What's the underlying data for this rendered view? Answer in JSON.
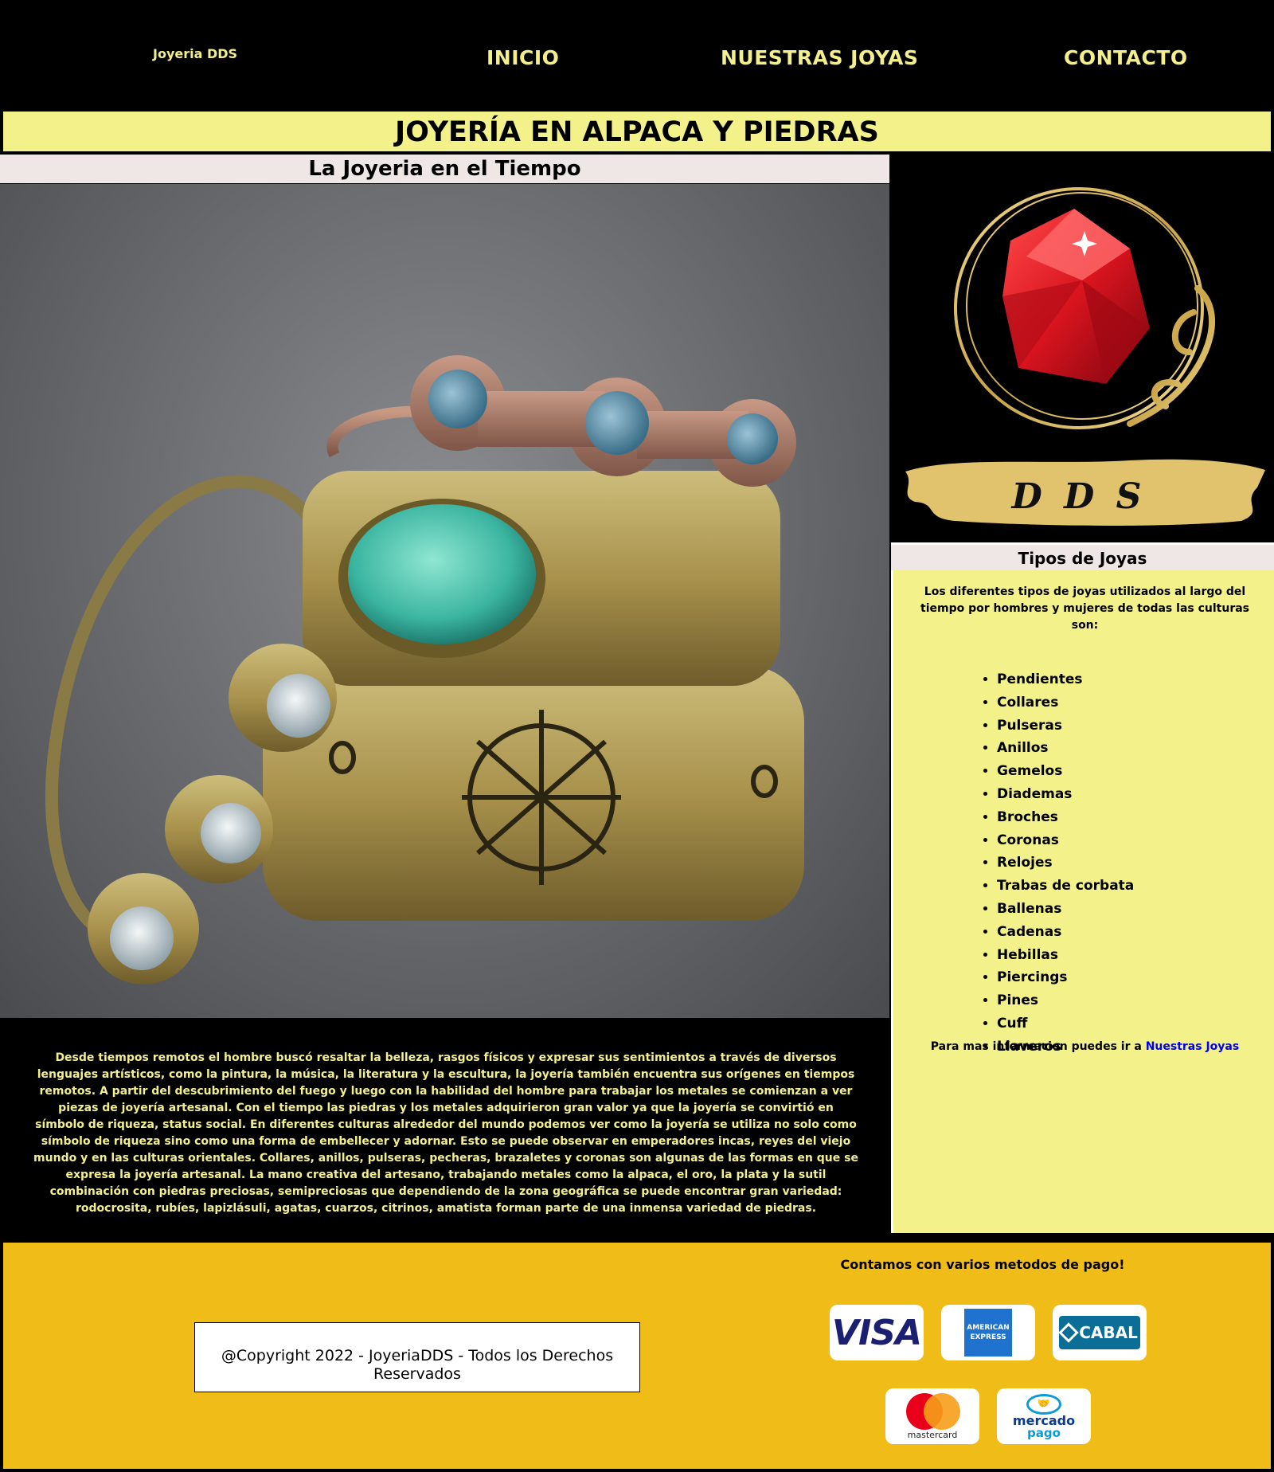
{
  "nav": {
    "brand": "Joyeria DDS",
    "links": [
      "INICIO",
      "NUESTRAS JOYAS",
      "CONTACTO"
    ]
  },
  "banner": {
    "title": "JOYERÍA EN ALPACA Y PIEDRAS"
  },
  "main": {
    "subtitle": "La Joyeria en el Tiempo",
    "story": "Desde tiempos remotos el hombre buscó resaltar la belleza, rasgos físicos y expresar sus sentimientos a través de diversos lenguajes artísticos, como la pintura, la música, la literatura y la escultura, la joyería también encuentra sus orígenes en tiempos remotos. A partir del descubrimiento del fuego y luego con la habilidad del hombre para trabajar los metales se comienzan a ver piezas de joyería artesanal. Con el tiempo las piedras y los metales adquirieron gran valor ya que la joyería se convirtió en símbolo de riqueza, status social. En diferentes culturas alrededor del mundo podemos ver como la joyería se utiliza no solo como símbolo de riqueza sino como una forma de embellecer y adornar. Esto se puede observar en emperadores incas, reyes del viejo mundo y en las culturas orientales. Collares, anillos, pulseras, pecheras, brazaletes y coronas son algunas de las formas en que se expresa la joyería artesanal. La mano creativa del artesano, trabajando metales como la alpaca, el oro, la plata y la sutil combinación con piedras preciosas, semipreciosas que dependiendo de la zona geográfica se puede encontrar gran variedad: rodocrosita, rubíes, lapizlásuli, agatas, cuarzos, citrinos, amatista forman parte de una inmensa variedad de piedras."
  },
  "sidebar": {
    "logo_text": "D D S",
    "title": "Tipos de Joyas",
    "intro": "Los diferentes tipos de joyas utilizados al largo del tiempo por hombres y mujeres de todas las culturas son:",
    "items": [
      "Pendientes",
      "Collares",
      "Pulseras",
      "Anillos",
      "Gemelos",
      "Diademas",
      "Broches",
      "Coronas",
      "Relojes",
      "Trabas de corbata",
      "Ballenas",
      "Cadenas",
      "Hebillas",
      "Piercings",
      "Pines",
      "Cuff",
      "Llaveros"
    ],
    "more_prefix": "Para mas informacion puedes ir a",
    "more_link": "Nuestras Joyas"
  },
  "footer": {
    "copyright": "@Copyright 2022 - JoyeriaDDS - Todos los Derechos Reservados",
    "payment_title": "Contamos con varios metodos de pago!",
    "payment_methods": {
      "visa": "VISA",
      "amex_line1": "AMERICAN",
      "amex_line2": "EXPRESS",
      "cabal": "CABAL",
      "mastercard": "mastercard",
      "mercadopago_line1": "mercado",
      "mercadopago_line2": "pago"
    }
  },
  "colors": {
    "accent_yellow": "#f3f18a",
    "nav_text": "#f2ef8c",
    "footer_bg": "#f0bc17",
    "link": "#0000ee"
  }
}
